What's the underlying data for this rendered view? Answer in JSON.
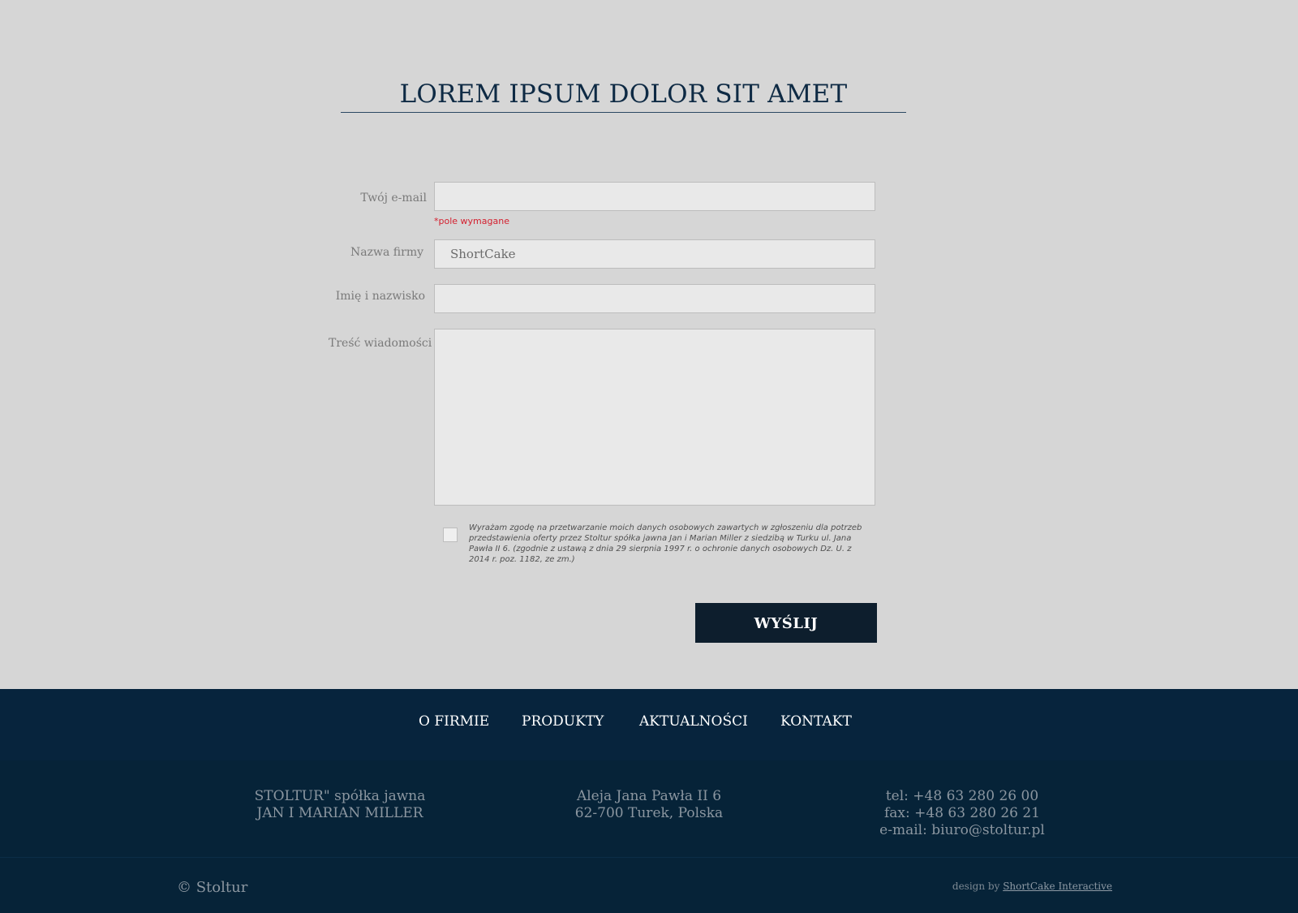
{
  "form": {
    "heading": "LOREM IPSUM DOLOR SIT AMET",
    "email_label": "Twój e-mail",
    "email_value": "",
    "required_note": "*pole wymagane",
    "company_label": "Nazwa firmy",
    "company_value": "ShortCake",
    "name_label": "Imię i nazwisko",
    "name_value": "",
    "message_label": "Treść wiadomości",
    "message_value": "",
    "consent_checked": false,
    "consent_text": "Wyrażam zgodę na przetwarzanie moich danych osobowych zawartych w zgłoszeniu dla potrzeb przedstawienia oferty przez Stoltur spółka jawna Jan i Marian Miller z siedzibą w Turku ul. Jana Pawła II 6. (zgodnie z ustawą z dnia 29 sierpnia 1997 r. o ochronie danych osobowych Dz. U. z 2014 r. poz. 1182, ze zm.)",
    "submit_label": "WYŚLIJ"
  },
  "nav": {
    "items": [
      {
        "label": "O FIRMIE"
      },
      {
        "label": "PRODUKTY"
      },
      {
        "label": "AKTUALNOŚCI"
      },
      {
        "label": "KONTAKT"
      }
    ]
  },
  "footer": {
    "company_line1": "STOLTUR\" spółka jawna",
    "company_line2": "JAN I MARIAN MILLER",
    "address_line1": "Aleja Jana Pawła II 6",
    "address_line2": "62-700 Turek, Polska",
    "tel": "tel: +48 63 280 26 00",
    "fax": "fax: +48 63 280 26 21",
    "email": "e-mail: biuro@stoltur.pl",
    "copyright": "© Stoltur",
    "credit_prefix": "design by",
    "credit_link": "ShortCake Interactive"
  },
  "colors": {
    "background": "#d6d6d6",
    "navy": "#07243d",
    "button": "#0d1e2d",
    "required": "#d4202f"
  }
}
